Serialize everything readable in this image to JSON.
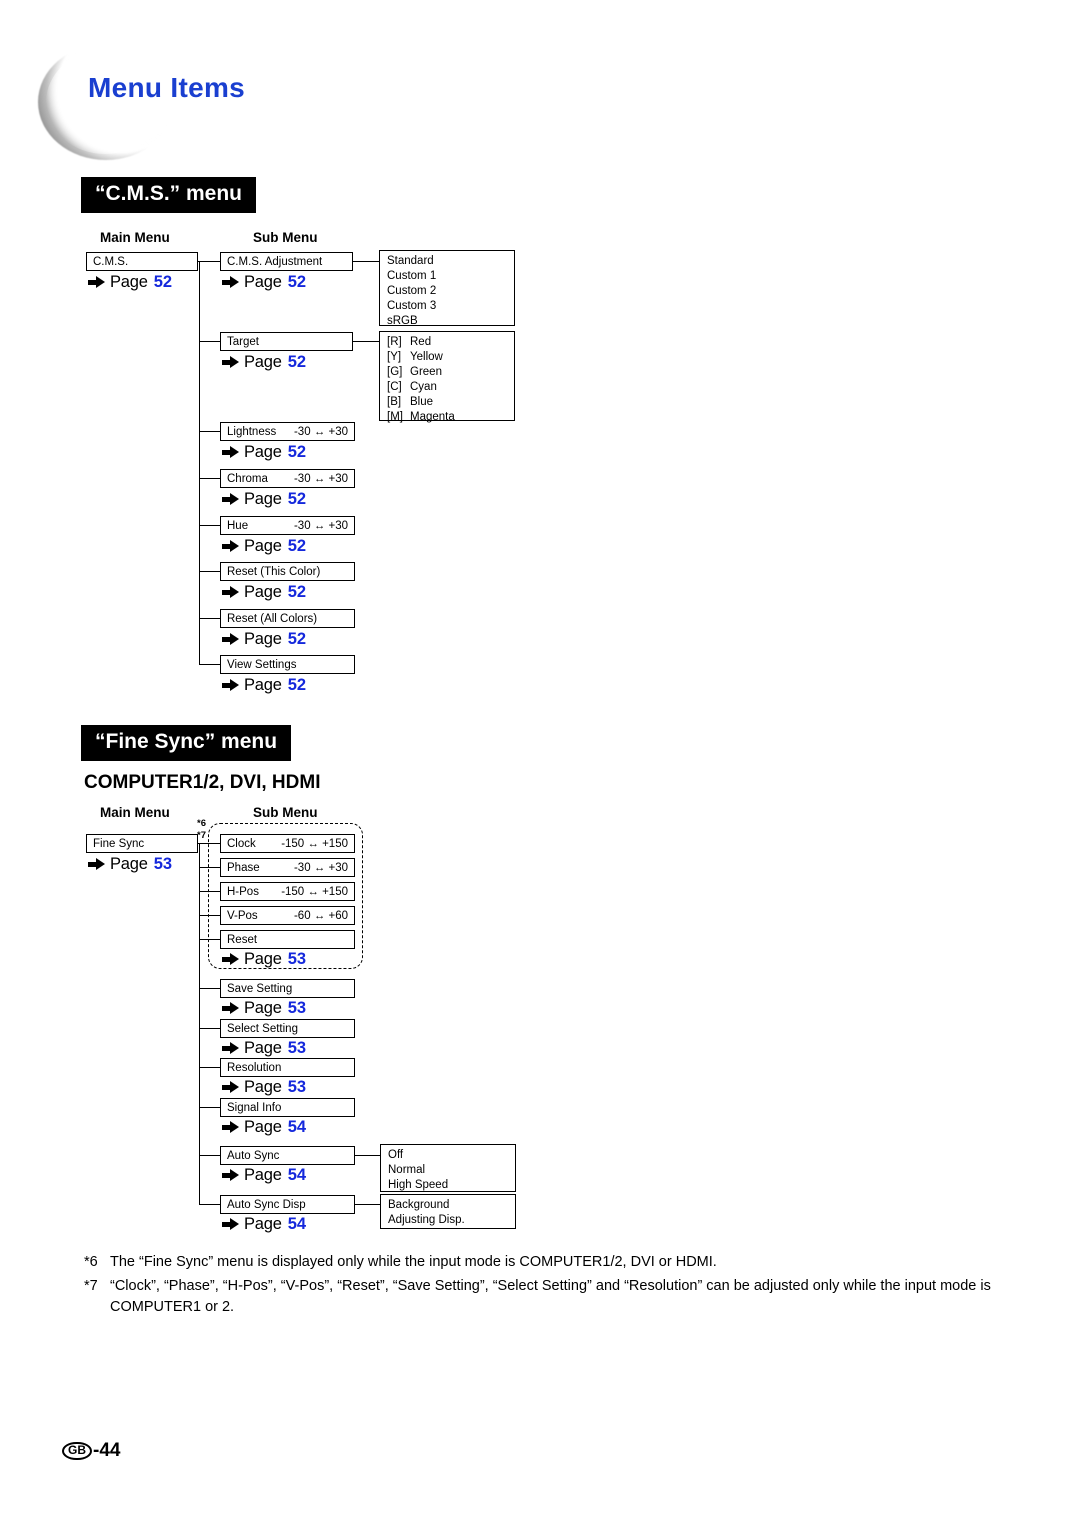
{
  "header": {
    "title": "Menu Items"
  },
  "sections": {
    "cms": {
      "banner": "“C.M.S.” menu",
      "col_main": "Main Menu",
      "col_sub": "Sub Menu",
      "main_item": {
        "label": "C.M.S.",
        "page_word": "Page",
        "page": "52"
      },
      "rows": [
        {
          "label": "C.M.S. Adjustment",
          "range": "",
          "page_word": "Page",
          "page": "52",
          "options": [
            "Standard",
            "Custom 1",
            "Custom 2",
            "Custom 3",
            "sRGB"
          ]
        },
        {
          "label": "Target",
          "range": "",
          "page_word": "Page",
          "page": "52",
          "options_tagged": [
            {
              "tag": "[R]",
              "name": "Red"
            },
            {
              "tag": "[Y]",
              "name": "Yellow"
            },
            {
              "tag": "[G]",
              "name": "Green"
            },
            {
              "tag": "[C]",
              "name": "Cyan"
            },
            {
              "tag": "[B]",
              "name": "Blue"
            },
            {
              "tag": "[M]",
              "name": "Magenta"
            }
          ]
        },
        {
          "label": "Lightness",
          "range": "-30 ↔ +30",
          "page_word": "Page",
          "page": "52"
        },
        {
          "label": "Chroma",
          "range": "-30 ↔ +30",
          "page_word": "Page",
          "page": "52"
        },
        {
          "label": "Hue",
          "range": "-30 ↔ +30",
          "page_word": "Page",
          "page": "52"
        },
        {
          "label": "Reset (This Color)",
          "range": "",
          "page_word": "Page",
          "page": "52"
        },
        {
          "label": "Reset (All Colors)",
          "range": "",
          "page_word": "Page",
          "page": "52"
        },
        {
          "label": "View Settings",
          "range": "",
          "page_word": "Page",
          "page": "52"
        }
      ]
    },
    "finesync": {
      "banner": "“Fine Sync” menu",
      "subheading": "COMPUTER1/2, DVI, HDMI",
      "col_main": "Main Menu",
      "col_sub": "Sub Menu",
      "footnote_marks": {
        "a": "*6",
        "b": "*7"
      },
      "main_item": {
        "label": "Fine Sync",
        "page_word": "Page",
        "page": "53"
      },
      "grouped": {
        "rows": [
          {
            "label": "Clock",
            "range": "-150 ↔ +150"
          },
          {
            "label": "Phase",
            "range": "-30 ↔  +30"
          },
          {
            "label": "H-Pos",
            "range": "-150 ↔ +150"
          },
          {
            "label": "V-Pos",
            "range": "-60 ↔  +60"
          },
          {
            "label": "Reset",
            "range": ""
          }
        ],
        "page_word": "Page",
        "page": "53"
      },
      "rows": [
        {
          "label": "Save Setting",
          "page_word": "Page",
          "page": "53"
        },
        {
          "label": "Select Setting",
          "page_word": "Page",
          "page": "53"
        },
        {
          "label": "Resolution",
          "page_word": "Page",
          "page": "53"
        },
        {
          "label": "Signal Info",
          "page_word": "Page",
          "page": "54"
        },
        {
          "label": "Auto Sync",
          "page_word": "Page",
          "page": "54",
          "options": [
            "Off",
            "Normal",
            "High Speed"
          ]
        },
        {
          "label": "Auto Sync Disp",
          "page_word": "Page",
          "page": "54",
          "options": [
            "Background",
            "Adjusting Disp."
          ]
        }
      ]
    }
  },
  "footnotes": [
    {
      "mark": "*6",
      "text": "The “Fine Sync” menu is displayed only while the input mode is COMPUTER1/2, DVI or HDMI."
    },
    {
      "mark": "*7",
      "text": "“Clock”, “Phase”, “H-Pos”, “V-Pos”, “Reset”, “Save Setting”, “Select Setting” and “Resolution” can be adjusted only while the input mode is COMPUTER1 or 2."
    }
  ],
  "page_footer": {
    "region": "GB",
    "number": "-44"
  },
  "colors": {
    "page_link": "#1428dc",
    "title": "#1a3fd0",
    "banner_bg": "#000000"
  }
}
